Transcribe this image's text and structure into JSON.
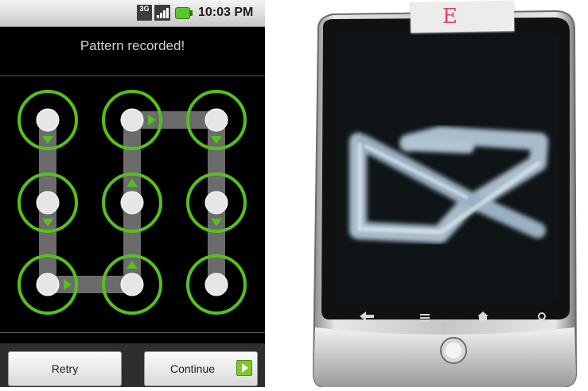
{
  "status_bar": {
    "network": "3G",
    "time": "10:03 PM"
  },
  "header": {
    "title": "Pattern recorded!"
  },
  "pattern": {
    "accent_color": "#55c11a",
    "sequence": [
      1,
      4,
      7,
      8,
      5,
      2,
      3,
      6,
      9
    ],
    "nodes": [
      {
        "n": 1,
        "label": "node-1"
      },
      {
        "n": 2,
        "label": "node-2"
      },
      {
        "n": 3,
        "label": "node-3"
      },
      {
        "n": 4,
        "label": "node-4"
      },
      {
        "n": 5,
        "label": "node-5"
      },
      {
        "n": 6,
        "label": "node-6"
      },
      {
        "n": 7,
        "label": "node-7"
      },
      {
        "n": 8,
        "label": "node-8"
      },
      {
        "n": 9,
        "label": "node-9"
      }
    ]
  },
  "buttons": {
    "retry": "Retry",
    "continue": "Continue"
  },
  "photo": {
    "tape_label": "E"
  },
  "icons": {
    "network": "3g-icon",
    "signal": "signal-icon",
    "battery": "battery-icon",
    "continue_arrow": "arrow-right-icon"
  }
}
